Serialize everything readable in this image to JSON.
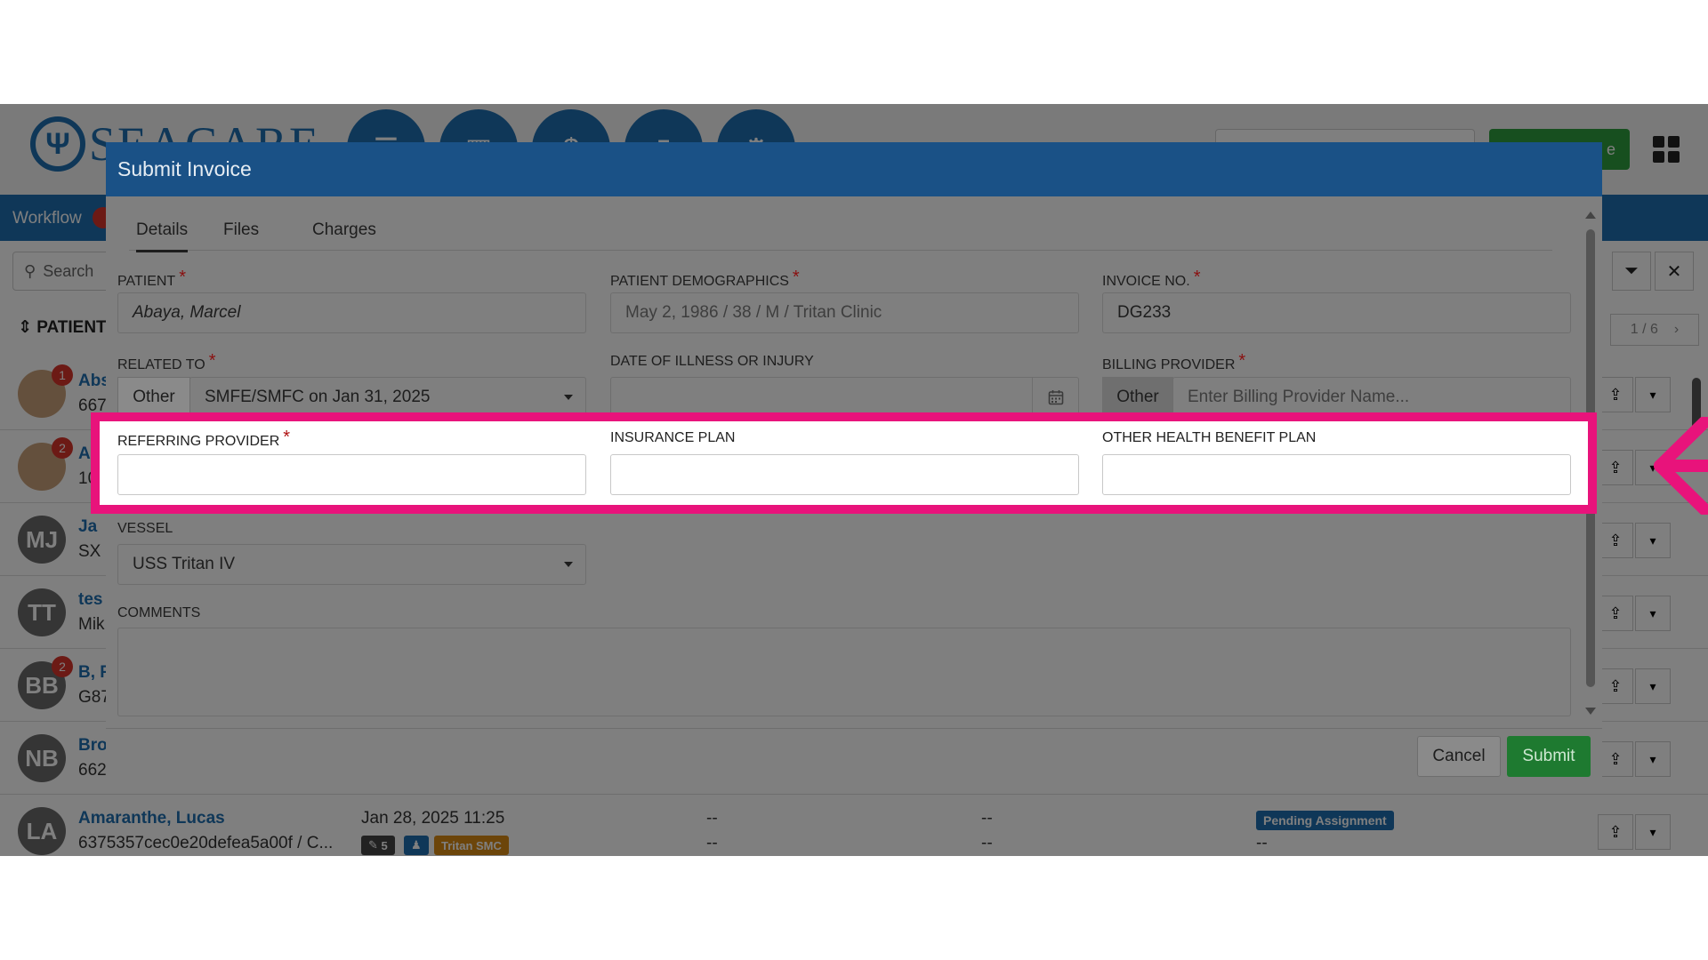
{
  "app": {
    "logo_text": "SEACARE",
    "top_button_label": "e",
    "workflow_label": "Workflow",
    "search_placeholder": "Search",
    "list_header": "PATIENT",
    "pager": "1 / 6"
  },
  "patients": [
    {
      "initials": "",
      "name": "Abs",
      "sub": "667",
      "badge": "1",
      "photo": true
    },
    {
      "initials": "",
      "name": "A",
      "sub": "10",
      "badge": "2",
      "photo": true
    },
    {
      "initials": "MJ",
      "name": "Ja",
      "sub": "SX",
      "badge": ""
    },
    {
      "initials": "TT",
      "name": "tes",
      "sub": "Mik",
      "badge": ""
    },
    {
      "initials": "BB",
      "name": "B, F",
      "sub": "G87",
      "badge": "2"
    },
    {
      "initials": "NB",
      "name": "Bro",
      "sub": "662",
      "badge": ""
    },
    {
      "initials": "LA",
      "name": "Amaranthe, Lucas",
      "sub": "6375357cec0e20defea5a00f / C...",
      "badge": "",
      "date": "Jan 28, 2025 11:25",
      "dash": "--",
      "chip_count": "5",
      "chip_org": "Tritan SMC",
      "status": "Pending Assignment"
    }
  ],
  "modal": {
    "title": "Submit Invoice",
    "tabs": [
      "Details",
      "Files",
      "Charges"
    ],
    "active_tab": "Details",
    "fields": {
      "patient": {
        "label": "PATIENT",
        "value": "Abaya, Marcel"
      },
      "demographics": {
        "label": "PATIENT DEMOGRAPHICS",
        "value": "May 2, 1986 / 38 / M / Tritan Clinic"
      },
      "invoice_no": {
        "label": "INVOICE NO.",
        "value": "DG233"
      },
      "related_to": {
        "label": "RELATED TO",
        "addon": "Other",
        "value": "SMFE/SMFC on Jan 31, 2025"
      },
      "date_of_illness": {
        "label": "DATE OF ILLNESS OR INJURY",
        "value": ""
      },
      "billing_provider": {
        "label": "BILLING PROVIDER",
        "addon": "Other",
        "placeholder": "Enter Billing Provider Name..."
      },
      "referring_provider": {
        "label": "REFERRING PROVIDER",
        "value": ""
      },
      "insurance_plan": {
        "label": "INSURANCE PLAN",
        "value": ""
      },
      "other_health_benefit_plan": {
        "label": "OTHER HEALTH BENEFIT PLAN",
        "value": ""
      },
      "vessel": {
        "label": "VESSEL",
        "value": "USS Tritan IV"
      },
      "comments": {
        "label": "COMMENTS",
        "value": ""
      }
    },
    "cancel_label": "Cancel",
    "submit_label": "Submit"
  },
  "colors": {
    "highlight_border": "#e8137b",
    "modal_header": "#1a5186",
    "primary": "#1f6fb0",
    "submit": "#2e9e3e"
  }
}
